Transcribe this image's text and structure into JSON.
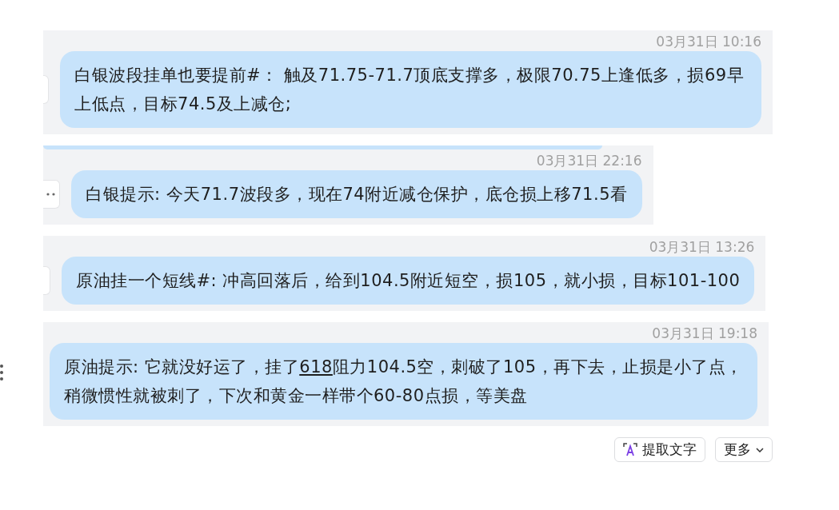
{
  "messages": [
    {
      "time": "03月31日 10:16",
      "handle": true,
      "handle_dots": false,
      "clipped_top": false,
      "side_menu": false,
      "text": [
        {
          "t": "白银波段挂单也要提前#： 触及71.75-71.7顶底支撑多，极限70.75上逢低多，损69早上低点，目标74.5及上减仓;",
          "underline": false
        }
      ]
    },
    {
      "time": "03月31日 22:16",
      "handle": true,
      "handle_dots": true,
      "clipped_top": true,
      "side_menu": false,
      "text": [
        {
          "t": "白银提示: 今天71.7波段多，现在74附近减仓保护，底仓损上移71.5看",
          "underline": false
        }
      ]
    },
    {
      "time": "03月31日 13:26",
      "handle": true,
      "handle_dots": false,
      "clipped_top": false,
      "side_menu": false,
      "text": [
        {
          "t": "原油挂一个短线#: 冲高回落后，给到104.5附近短空，损105，就小损，目标101-100",
          "underline": false
        }
      ]
    },
    {
      "time": "03月31日 19:18",
      "handle": false,
      "clipped_top": false,
      "side_menu": true,
      "text": [
        {
          "t": "原油提示: 它就没好运了，挂了",
          "underline": false
        },
        {
          "t": "618",
          "underline": true
        },
        {
          "t": "阻力104.5空，刺破了105，再下去，止损是小了点，稍微惯性就被刺了，下次和黄金一样带个60-80点损，等美盘",
          "underline": false
        }
      ]
    }
  ],
  "actions": [
    {
      "kind": "extract",
      "label": "提取文字"
    },
    {
      "kind": "more",
      "label": "更多"
    }
  ]
}
